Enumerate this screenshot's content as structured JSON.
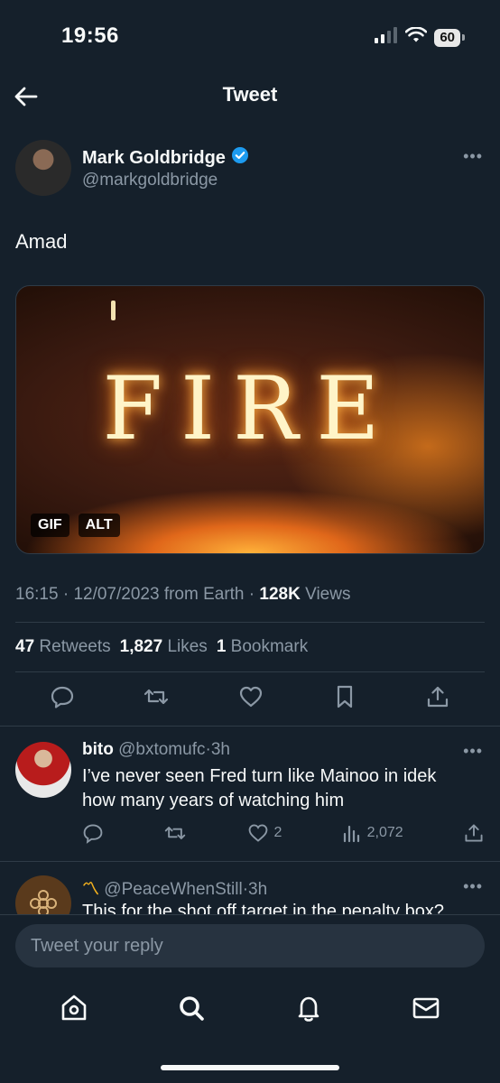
{
  "status_bar": {
    "time": "19:56",
    "battery": "60"
  },
  "header": {
    "title": "Tweet"
  },
  "tweet": {
    "author_name": "Mark Goldbridge",
    "author_handle": "@markgoldbridge",
    "text": "Amad",
    "media": {
      "overlay_text": "FIRE",
      "badges": [
        "GIF",
        "ALT"
      ]
    },
    "meta": {
      "time": "16:15",
      "date": "12/07/2023",
      "source": "from Earth",
      "views_count": "128K",
      "views_label": "Views",
      "sep": "·"
    },
    "stats": {
      "retweets_count": "47",
      "retweets_label": "Retweets",
      "likes_count": "1,827",
      "likes_label": "Likes",
      "bookmarks_count": "1",
      "bookmarks_label": "Bookmark"
    }
  },
  "replies": [
    {
      "name": "bito",
      "handle": "@bxtomufc",
      "age": "3h",
      "text": "I’ve never seen Fred turn like Mainoo in idek how many years of watching him",
      "likes": "2",
      "views": "2,072"
    },
    {
      "name_emoji": "〽",
      "handle": "@PeaceWhenStill",
      "age": "3h",
      "text": "This for the shot off target in the penalty box?"
    }
  ],
  "compose": {
    "placeholder": "Tweet your reply"
  },
  "colors": {
    "background": "#15202b",
    "muted": "#8b98a5",
    "verified": "#1d9bf0",
    "text": "#f7f9f9"
  }
}
